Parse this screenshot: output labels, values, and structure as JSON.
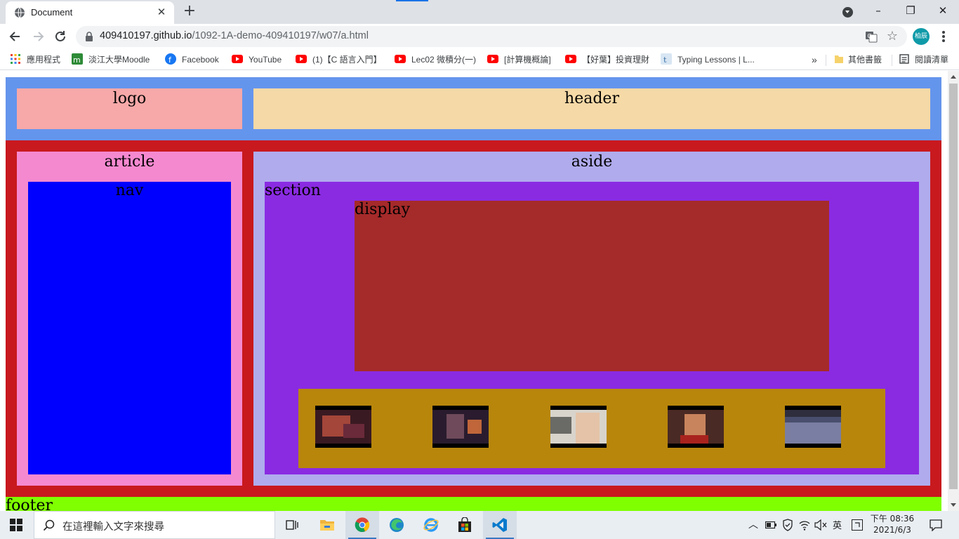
{
  "browser": {
    "tab_title": "Document",
    "url_host": "409410197.github.io",
    "url_path": "/1092-1A-demo-409410197/w07/a.html",
    "profile_initials": "柏辰",
    "bookmarks": [
      {
        "label": "應用程式",
        "icon": "apps-grid-icon"
      },
      {
        "label": "淡江大學Moodle",
        "icon": "moodle-icon"
      },
      {
        "label": "Facebook",
        "icon": "facebook-icon"
      },
      {
        "label": "YouTube",
        "icon": "youtube-icon"
      },
      {
        "label": "(1)【C 語言入門】",
        "icon": "youtube-icon"
      },
      {
        "label": "Lec02 微積分(一)",
        "icon": "youtube-icon"
      },
      {
        "label": "[計算機概論]",
        "icon": "youtube-icon"
      },
      {
        "label": "【好葉】投資理財",
        "icon": "youtube-icon"
      },
      {
        "label": "Typing Lessons | L...",
        "icon": "typing-icon"
      }
    ],
    "overflow_label": "»",
    "other_bookmarks": "其他書籤",
    "reading_list": "閱讀清單"
  },
  "page": {
    "logo": "logo",
    "header": "header",
    "article": "article",
    "nav": "nav",
    "aside": "aside",
    "section": "section",
    "display": "display",
    "footer": "footer",
    "thumbnails": [
      "video-thumbnail-1",
      "video-thumbnail-2",
      "video-thumbnail-3",
      "video-thumbnail-4",
      "video-thumbnail-5"
    ],
    "colors": {
      "header_bar": "#6495ed",
      "logo": "#f7a8a8",
      "header": "#f5d9a6",
      "main_bar": "#c8191e",
      "article": "#f589d0",
      "nav": "#0000ff",
      "aside": "#b0abed",
      "section": "#8a2be2",
      "display": "#a52a2a",
      "gallery": "#b8860b",
      "footer": "#7fff00"
    }
  },
  "taskbar": {
    "search_placeholder": "在這裡輸入文字來搜尋",
    "ime": "英",
    "time": "下午 08:36",
    "date": "2021/6/3",
    "apps": [
      "task-view-icon",
      "file-explorer-icon",
      "chrome-icon",
      "edge-icon",
      "ie-icon",
      "store-icon",
      "vscode-icon"
    ]
  }
}
